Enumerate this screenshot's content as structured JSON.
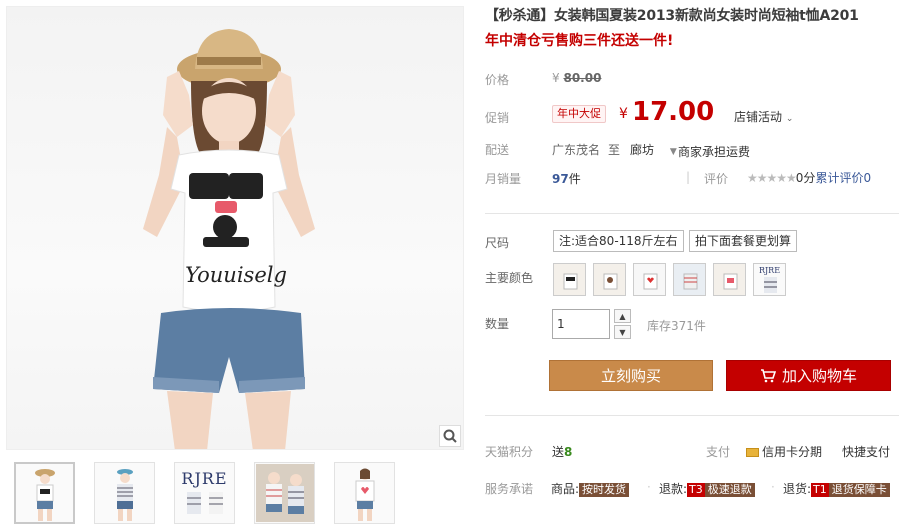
{
  "product": {
    "title": "【秒杀通】女装韩国夏装2013新款尚女装时尚短袖t恤A201",
    "subtitle": "年中清仓亏售购三件还送一件!"
  },
  "price": {
    "label": "价格",
    "currency": "¥",
    "original": "80.00"
  },
  "promo": {
    "label": "促销",
    "tag": "年中大促",
    "currency": "¥",
    "price": "17.00",
    "store_activity": "店铺活动"
  },
  "shipping": {
    "label": "配送",
    "from": "广东茂名",
    "to_word": "至",
    "destination": "廊坊",
    "fee": "商家承担运费"
  },
  "sales": {
    "label": "月销量",
    "count": "97",
    "unit": "件",
    "rating_label": "评价",
    "rating": "0分",
    "review_text": "累计评价",
    "review_count": "0"
  },
  "size": {
    "label": "尺码",
    "options": [
      "注:适合80-118斤左右",
      "拍下面套餐更划算"
    ]
  },
  "color": {
    "label": "主要颜色",
    "swatches": 6
  },
  "quantity": {
    "label": "数量",
    "value": "1",
    "stock": "库存371件"
  },
  "buttons": {
    "buy_now": "立刻购买",
    "add_cart": "加入购物车"
  },
  "points": {
    "label": "天猫积分",
    "send": "送",
    "value": "8",
    "pay_label": "支付",
    "credit": "信用卡分期",
    "quick_pay": "快捷支付"
  },
  "service": {
    "label": "服务承诺",
    "goods": "商品:",
    "goods_badge": "按时发货",
    "refund": "退款:",
    "refund_badge_code": "T3",
    "refund_badge": "极速退款",
    "return": "退货:",
    "return_badge_code": "T1",
    "return_badge": "退货保障卡"
  },
  "thumbs_logo": "RJRE",
  "shirt_text": "Youuiselg",
  "colors": {
    "accent_red": "#c40000",
    "buy_orange": "#c98a4a",
    "badge_brown": "#7a4f36"
  }
}
